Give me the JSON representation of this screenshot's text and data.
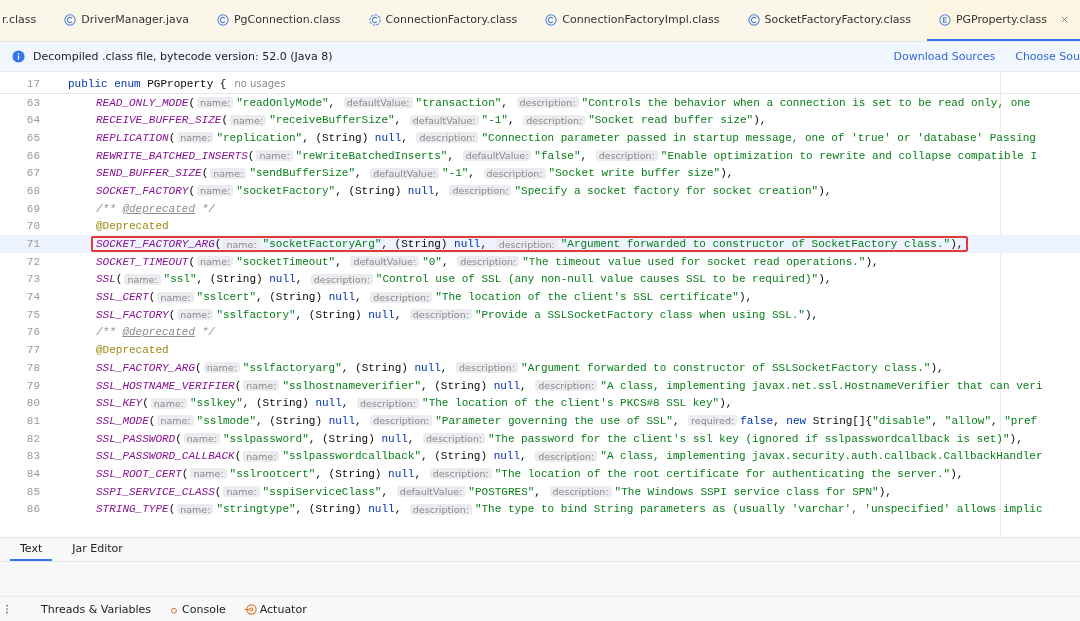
{
  "tabs": [
    {
      "label": "r.class",
      "kind": "plain",
      "selected": false
    },
    {
      "label": "DriverManager.java",
      "kind": "class",
      "selected": false
    },
    {
      "label": "PgConnection.class",
      "kind": "class",
      "selected": false
    },
    {
      "label": "ConnectionFactory.class",
      "kind": "abstract",
      "selected": false
    },
    {
      "label": "ConnectionFactoryImpl.class",
      "kind": "class",
      "selected": false
    },
    {
      "label": "SocketFactoryFactory.class",
      "kind": "class",
      "selected": false
    },
    {
      "label": "PGProperty.class",
      "kind": "enum",
      "selected": true
    }
  ],
  "info_bar": {
    "message": "Decompiled .class file, bytecode version: 52.0 (Java 8)",
    "links": [
      "Download Sources",
      "Choose Sou"
    ]
  },
  "lines": [
    {
      "number": "17",
      "selected": false,
      "boxed": false,
      "tokens": [
        {
          "kind": "kw",
          "text": "public enum"
        },
        {
          "kind": "p",
          "text": " PGProperty {"
        },
        {
          "kind": "usage",
          "text": "no usages"
        }
      ],
      "children": [
        {
          "number": "63",
          "selected": false,
          "boxed": false,
          "tokens": [
            {
              "kind": "id",
              "text": "READ_ONLY_MODE"
            },
            {
              "kind": "p",
              "text": "("
            },
            {
              "kind": "hint",
              "text": "name:"
            },
            {
              "kind": "str",
              "text": "\"readOnlyMode\""
            },
            {
              "kind": "p",
              "text": ", "
            },
            {
              "kind": "hint",
              "text": "defaultValue:"
            },
            {
              "kind": "str",
              "text": "\"transaction\""
            },
            {
              "kind": "p",
              "text": ", "
            },
            {
              "kind": "hint",
              "text": "description:"
            },
            {
              "kind": "str",
              "text": "\"Controls the behavior when a connection is set to be read only, one"
            }
          ]
        },
        {
          "number": "64",
          "selected": false,
          "boxed": false,
          "tokens": [
            {
              "kind": "id",
              "text": "RECEIVE_BUFFER_SIZE"
            },
            {
              "kind": "p",
              "text": "("
            },
            {
              "kind": "hint",
              "text": "name:"
            },
            {
              "kind": "str",
              "text": "\"receiveBufferSize\""
            },
            {
              "kind": "p",
              "text": ", "
            },
            {
              "kind": "hint",
              "text": "defaultValue:"
            },
            {
              "kind": "str",
              "text": "\"-1\""
            },
            {
              "kind": "p",
              "text": ", "
            },
            {
              "kind": "hint",
              "text": "description:"
            },
            {
              "kind": "str",
              "text": "\"Socket read buffer size\""
            },
            {
              "kind": "p",
              "text": "),"
            }
          ]
        },
        {
          "number": "65",
          "selected": false,
          "boxed": false,
          "tokens": [
            {
              "kind": "id",
              "text": "REPLICATION"
            },
            {
              "kind": "p",
              "text": "("
            },
            {
              "kind": "hint",
              "text": "name:"
            },
            {
              "kind": "str",
              "text": "\"replication\""
            },
            {
              "kind": "p",
              "text": ", (String) "
            },
            {
              "kind": "kw",
              "text": "null"
            },
            {
              "kind": "p",
              "text": ", "
            },
            {
              "kind": "hint",
              "text": "description:"
            },
            {
              "kind": "str",
              "text": "\"Connection parameter passed in startup message, one of 'true' or 'database' Passing"
            }
          ]
        },
        {
          "number": "66",
          "selected": false,
          "boxed": false,
          "tokens": [
            {
              "kind": "id",
              "text": "REWRITE_BATCHED_INSERTS"
            },
            {
              "kind": "p",
              "text": "("
            },
            {
              "kind": "hint",
              "text": "name:"
            },
            {
              "kind": "str",
              "text": "\"reWriteBatchedInserts\""
            },
            {
              "kind": "p",
              "text": ", "
            },
            {
              "kind": "hint",
              "text": "defaultValue:"
            },
            {
              "kind": "str",
              "text": "\"false\""
            },
            {
              "kind": "p",
              "text": ", "
            },
            {
              "kind": "hint",
              "text": "description:"
            },
            {
              "kind": "str",
              "text": "\"Enable optimization to rewrite and collapse compatible I"
            }
          ]
        },
        {
          "number": "67",
          "selected": false,
          "boxed": false,
          "tokens": [
            {
              "kind": "id",
              "text": "SEND_BUFFER_SIZE"
            },
            {
              "kind": "p",
              "text": "("
            },
            {
              "kind": "hint",
              "text": "name:"
            },
            {
              "kind": "str",
              "text": "\"sendBufferSize\""
            },
            {
              "kind": "p",
              "text": ", "
            },
            {
              "kind": "hint",
              "text": "defaultValue:"
            },
            {
              "kind": "str",
              "text": "\"-1\""
            },
            {
              "kind": "p",
              "text": ", "
            },
            {
              "kind": "hint",
              "text": "description:"
            },
            {
              "kind": "str",
              "text": "\"Socket write buffer size\""
            },
            {
              "kind": "p",
              "text": "),"
            }
          ]
        },
        {
          "number": "68",
          "selected": false,
          "boxed": false,
          "tokens": [
            {
              "kind": "id",
              "text": "SOCKET_FACTORY"
            },
            {
              "kind": "p",
              "text": "("
            },
            {
              "kind": "hint",
              "text": "name:"
            },
            {
              "kind": "str",
              "text": "\"socketFactory\""
            },
            {
              "kind": "p",
              "text": ", (String) "
            },
            {
              "kind": "kw",
              "text": "null"
            },
            {
              "kind": "p",
              "text": ", "
            },
            {
              "kind": "hint",
              "text": "description:"
            },
            {
              "kind": "str",
              "text": "\"Specify a socket factory for socket creation\""
            },
            {
              "kind": "p",
              "text": "),"
            }
          ]
        },
        {
          "number": "69",
          "selected": false,
          "boxed": false,
          "tokens": [
            {
              "kind": "cm",
              "text": "/** "
            },
            {
              "kind": "tag",
              "text": "@deprecated"
            },
            {
              "kind": "cm",
              "text": " */"
            }
          ]
        },
        {
          "number": "70",
          "selected": false,
          "boxed": false,
          "tokens": [
            {
              "kind": "ann",
              "text": "@Deprecated"
            }
          ]
        },
        {
          "number": "71",
          "selected": true,
          "boxed": true,
          "tokens": [
            {
              "kind": "id",
              "text": "SOCKET_FACTORY_ARG"
            },
            {
              "kind": "p",
              "text": "("
            },
            {
              "kind": "hint",
              "text": "name:"
            },
            {
              "kind": "str",
              "text": "\"socketFactoryArg\""
            },
            {
              "kind": "p",
              "text": ", (String) "
            },
            {
              "kind": "kw",
              "text": "null"
            },
            {
              "kind": "p",
              "text": ", "
            },
            {
              "kind": "hint",
              "text": "description:"
            },
            {
              "kind": "str",
              "text": "\"Argument forwarded to constructor of SocketFactory class.\""
            },
            {
              "kind": "p",
              "text": "),"
            }
          ]
        },
        {
          "number": "72",
          "selected": false,
          "boxed": false,
          "tokens": [
            {
              "kind": "id",
              "text": "SOCKET_TIMEOUT"
            },
            {
              "kind": "p",
              "text": "("
            },
            {
              "kind": "hint",
              "text": "name:"
            },
            {
              "kind": "str",
              "text": "\"socketTimeout\""
            },
            {
              "kind": "p",
              "text": ", "
            },
            {
              "kind": "hint",
              "text": "defaultValue:"
            },
            {
              "kind": "str",
              "text": "\"0\""
            },
            {
              "kind": "p",
              "text": ", "
            },
            {
              "kind": "hint",
              "text": "description:"
            },
            {
              "kind": "str",
              "text": "\"The timeout value used for socket read operations.\""
            },
            {
              "kind": "p",
              "text": "),"
            }
          ]
        },
        {
          "number": "73",
          "selected": false,
          "boxed": false,
          "tokens": [
            {
              "kind": "id",
              "text": "SSL"
            },
            {
              "kind": "p",
              "text": "("
            },
            {
              "kind": "hint",
              "text": "name:"
            },
            {
              "kind": "str",
              "text": "\"ssl\""
            },
            {
              "kind": "p",
              "text": ", (String) "
            },
            {
              "kind": "kw",
              "text": "null"
            },
            {
              "kind": "p",
              "text": ", "
            },
            {
              "kind": "hint",
              "text": "description:"
            },
            {
              "kind": "str",
              "text": "\"Control use of SSL (any non-null value causes SSL to be required)\""
            },
            {
              "kind": "p",
              "text": "),"
            }
          ]
        },
        {
          "number": "74",
          "selected": false,
          "boxed": false,
          "tokens": [
            {
              "kind": "id",
              "text": "SSL_CERT"
            },
            {
              "kind": "p",
              "text": "("
            },
            {
              "kind": "hint",
              "text": "name:"
            },
            {
              "kind": "str",
              "text": "\"sslcert\""
            },
            {
              "kind": "p",
              "text": ", (String) "
            },
            {
              "kind": "kw",
              "text": "null"
            },
            {
              "kind": "p",
              "text": ", "
            },
            {
              "kind": "hint",
              "text": "description:"
            },
            {
              "kind": "str",
              "text": "\"The location of the client's SSL certificate\""
            },
            {
              "kind": "p",
              "text": "),"
            }
          ]
        },
        {
          "number": "75",
          "selected": false,
          "boxed": false,
          "tokens": [
            {
              "kind": "id",
              "text": "SSL_FACTORY"
            },
            {
              "kind": "p",
              "text": "("
            },
            {
              "kind": "hint",
              "text": "name:"
            },
            {
              "kind": "str",
              "text": "\"sslfactory\""
            },
            {
              "kind": "p",
              "text": ", (String) "
            },
            {
              "kind": "kw",
              "text": "null"
            },
            {
              "kind": "p",
              "text": ", "
            },
            {
              "kind": "hint",
              "text": "description:"
            },
            {
              "kind": "str",
              "text": "\"Provide a SSLSocketFactory class when using SSL.\""
            },
            {
              "kind": "p",
              "text": "),"
            }
          ]
        },
        {
          "number": "76",
          "selected": false,
          "boxed": false,
          "tokens": [
            {
              "kind": "cm",
              "text": "/** "
            },
            {
              "kind": "tag",
              "text": "@deprecated"
            },
            {
              "kind": "cm",
              "text": " */"
            }
          ]
        },
        {
          "number": "77",
          "selected": false,
          "boxed": false,
          "tokens": [
            {
              "kind": "ann",
              "text": "@Deprecated"
            }
          ]
        },
        {
          "number": "78",
          "selected": false,
          "boxed": false,
          "tokens": [
            {
              "kind": "id",
              "text": "SSL_FACTORY_ARG"
            },
            {
              "kind": "p",
              "text": "("
            },
            {
              "kind": "hint",
              "text": "name:"
            },
            {
              "kind": "str",
              "text": "\"sslfactoryarg\""
            },
            {
              "kind": "p",
              "text": ", (String) "
            },
            {
              "kind": "kw",
              "text": "null"
            },
            {
              "kind": "p",
              "text": ", "
            },
            {
              "kind": "hint",
              "text": "description:"
            },
            {
              "kind": "str",
              "text": "\"Argument forwarded to constructor of SSLSocketFactory class.\""
            },
            {
              "kind": "p",
              "text": "),"
            }
          ]
        },
        {
          "number": "79",
          "selected": false,
          "boxed": false,
          "tokens": [
            {
              "kind": "id",
              "text": "SSL_HOSTNAME_VERIFIER"
            },
            {
              "kind": "p",
              "text": "("
            },
            {
              "kind": "hint",
              "text": "name:"
            },
            {
              "kind": "str",
              "text": "\"sslhostnameverifier\""
            },
            {
              "kind": "p",
              "text": ", (String) "
            },
            {
              "kind": "kw",
              "text": "null"
            },
            {
              "kind": "p",
              "text": ", "
            },
            {
              "kind": "hint",
              "text": "description:"
            },
            {
              "kind": "str",
              "text": "\"A class, implementing javax.net.ssl.HostnameVerifier that can veri"
            }
          ]
        },
        {
          "number": "80",
          "selected": false,
          "boxed": false,
          "tokens": [
            {
              "kind": "id",
              "text": "SSL_KEY"
            },
            {
              "kind": "p",
              "text": "("
            },
            {
              "kind": "hint",
              "text": "name:"
            },
            {
              "kind": "str",
              "text": "\"sslkey\""
            },
            {
              "kind": "p",
              "text": ", (String) "
            },
            {
              "kind": "kw",
              "text": "null"
            },
            {
              "kind": "p",
              "text": ", "
            },
            {
              "kind": "hint",
              "text": "description:"
            },
            {
              "kind": "str",
              "text": "\"The location of the client's PKCS#8 SSL key\""
            },
            {
              "kind": "p",
              "text": "),"
            }
          ]
        },
        {
          "number": "81",
          "selected": false,
          "boxed": false,
          "tokens": [
            {
              "kind": "id",
              "text": "SSL_MODE"
            },
            {
              "kind": "p",
              "text": "("
            },
            {
              "kind": "hint",
              "text": "name:"
            },
            {
              "kind": "str",
              "text": "\"sslmode\""
            },
            {
              "kind": "p",
              "text": ", (String) "
            },
            {
              "kind": "kw",
              "text": "null"
            },
            {
              "kind": "p",
              "text": ", "
            },
            {
              "kind": "hint",
              "text": "description:"
            },
            {
              "kind": "str",
              "text": "\"Parameter governing the use of SSL\""
            },
            {
              "kind": "p",
              "text": ", "
            },
            {
              "kind": "hint",
              "text": "required:"
            },
            {
              "kind": "kw",
              "text": "false"
            },
            {
              "kind": "p",
              "text": ", "
            },
            {
              "kind": "kw",
              "text": "new"
            },
            {
              "kind": "p",
              "text": " String[]{"
            },
            {
              "kind": "str",
              "text": "\"disable\""
            },
            {
              "kind": "p",
              "text": ", "
            },
            {
              "kind": "str",
              "text": "\"allow\""
            },
            {
              "kind": "p",
              "text": ", "
            },
            {
              "kind": "str",
              "text": "\"pref"
            }
          ]
        },
        {
          "number": "82",
          "selected": false,
          "boxed": false,
          "tokens": [
            {
              "kind": "id",
              "text": "SSL_PASSWORD"
            },
            {
              "kind": "p",
              "text": "("
            },
            {
              "kind": "hint",
              "text": "name:"
            },
            {
              "kind": "str",
              "text": "\"sslpassword\""
            },
            {
              "kind": "p",
              "text": ", (String) "
            },
            {
              "kind": "kw",
              "text": "null"
            },
            {
              "kind": "p",
              "text": ", "
            },
            {
              "kind": "hint",
              "text": "description:"
            },
            {
              "kind": "str",
              "text": "\"The password for the client's ssl key (ignored if sslpasswordcallback is set)\""
            },
            {
              "kind": "p",
              "text": "),"
            }
          ]
        },
        {
          "number": "83",
          "selected": false,
          "boxed": false,
          "tokens": [
            {
              "kind": "id",
              "text": "SSL_PASSWORD_CALLBACK"
            },
            {
              "kind": "p",
              "text": "("
            },
            {
              "kind": "hint",
              "text": "name:"
            },
            {
              "kind": "str",
              "text": "\"sslpasswordcallback\""
            },
            {
              "kind": "p",
              "text": ", (String) "
            },
            {
              "kind": "kw",
              "text": "null"
            },
            {
              "kind": "p",
              "text": ", "
            },
            {
              "kind": "hint",
              "text": "description:"
            },
            {
              "kind": "str",
              "text": "\"A class, implementing javax.security.auth.callback.CallbackHandler"
            }
          ]
        },
        {
          "number": "84",
          "selected": false,
          "boxed": false,
          "tokens": [
            {
              "kind": "id",
              "text": "SSL_ROOT_CERT"
            },
            {
              "kind": "p",
              "text": "("
            },
            {
              "kind": "hint",
              "text": "name:"
            },
            {
              "kind": "str",
              "text": "\"sslrootcert\""
            },
            {
              "kind": "p",
              "text": ", (String) "
            },
            {
              "kind": "kw",
              "text": "null"
            },
            {
              "kind": "p",
              "text": ", "
            },
            {
              "kind": "hint",
              "text": "description:"
            },
            {
              "kind": "str",
              "text": "\"The location of the root certificate for authenticating the server.\""
            },
            {
              "kind": "p",
              "text": "),"
            }
          ]
        },
        {
          "number": "85",
          "selected": false,
          "boxed": false,
          "tokens": [
            {
              "kind": "id",
              "text": "SSPI_SERVICE_CLASS"
            },
            {
              "kind": "p",
              "text": "("
            },
            {
              "kind": "hint",
              "text": "name:"
            },
            {
              "kind": "str",
              "text": "\"sspiServiceClass\""
            },
            {
              "kind": "p",
              "text": ", "
            },
            {
              "kind": "hint",
              "text": "defaultValue:"
            },
            {
              "kind": "str",
              "text": "\"POSTGRES\""
            },
            {
              "kind": "p",
              "text": ", "
            },
            {
              "kind": "hint",
              "text": "description:"
            },
            {
              "kind": "str",
              "text": "\"The Windows SSPI service class for SPN\""
            },
            {
              "kind": "p",
              "text": "),"
            }
          ]
        },
        {
          "number": "86",
          "selected": false,
          "boxed": false,
          "tokens": [
            {
              "kind": "id",
              "text": "STRING_TYPE"
            },
            {
              "kind": "p",
              "text": "("
            },
            {
              "kind": "hint",
              "text": "name:"
            },
            {
              "kind": "str",
              "text": "\"stringtype\""
            },
            {
              "kind": "p",
              "text": ", (String) "
            },
            {
              "kind": "kw",
              "text": "null"
            },
            {
              "kind": "p",
              "text": ", "
            },
            {
              "kind": "hint",
              "text": "description:"
            },
            {
              "kind": "str",
              "text": "\"The type to bind String parameters as (usually 'varchar', 'unspecified' allows implic"
            }
          ]
        }
      ]
    }
  ],
  "editor_tabs": [
    {
      "label": "Text",
      "selected": true
    },
    {
      "label": "Jar Editor",
      "selected": false
    }
  ],
  "tool_windows": [
    {
      "label": "Threads & Variables",
      "kind": "plain"
    },
    {
      "label": "Console",
      "kind": "console"
    },
    {
      "label": "Actuator",
      "kind": "actuator"
    }
  ]
}
